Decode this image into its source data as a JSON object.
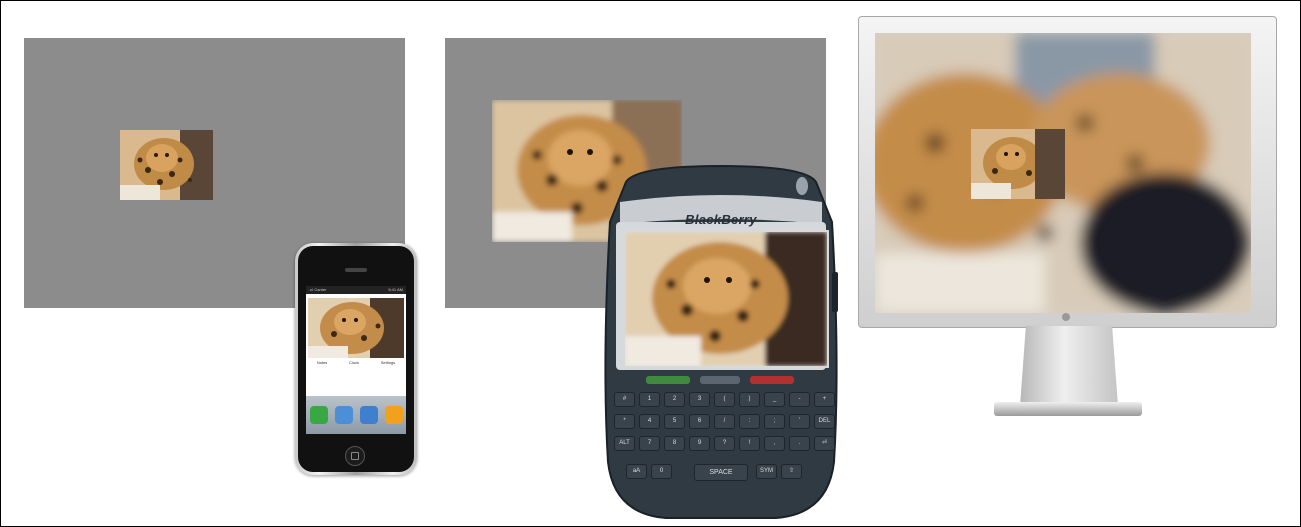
{
  "scene": {
    "colors": {
      "panel_gray": "#8c8c8c",
      "frame_border": "#000000",
      "bb_body": "#2f3a43",
      "monitor_silver": "#d9d9d9"
    },
    "panels": [
      {
        "thumbnail": "leopard-photo-small"
      },
      {
        "thumbnail": "leopard-photo-medium-blurred"
      }
    ],
    "iphone": {
      "status_carrier": ".ııl Carrier",
      "status_time": "5:41 AM",
      "tabs": [
        "Notes",
        "Clock",
        "Settings"
      ],
      "dock_icons": [
        "phone-icon",
        "mail-icon",
        "safari-icon",
        "ipod-icon"
      ],
      "dock_colors": [
        "#38a843",
        "#4b8fd6",
        "#3f7fd0",
        "#f2a11c"
      ]
    },
    "blackberry": {
      "brand": "BlackBerry",
      "space_label": "SPACE",
      "rows": [
        [
          "#",
          "1",
          "2",
          "3",
          "(",
          ")",
          "_",
          "-",
          "+",
          "@"
        ],
        [
          "*",
          "4",
          "5",
          "6",
          "/",
          ":",
          ";",
          "'",
          "\"",
          "DEL"
        ],
        [
          "ALT",
          "7",
          "8",
          "9",
          "?",
          "!",
          ",",
          ".",
          "⏎",
          ""
        ],
        [
          "aA",
          "0",
          "",
          "",
          "",
          "",
          "",
          "SYM",
          "⇧",
          ""
        ]
      ]
    },
    "monitor": {
      "image": "leopard-and-panther-photo-blurred"
    }
  }
}
